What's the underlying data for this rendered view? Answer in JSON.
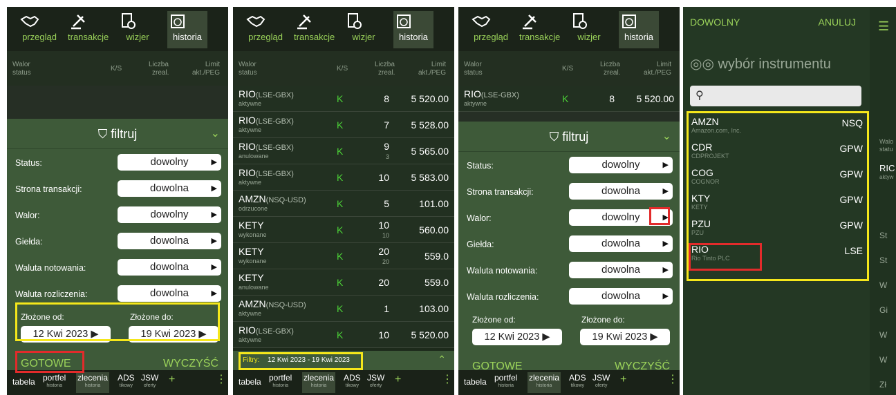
{
  "nav": {
    "tabs": [
      {
        "label": "przegląd",
        "icon": "handshake-icon"
      },
      {
        "label": "transakcje",
        "icon": "gavel-icon"
      },
      {
        "label": "wizjer",
        "icon": "document-clock-icon"
      },
      {
        "label": "historia",
        "icon": "calendar-clock-icon"
      }
    ],
    "active": "historia"
  },
  "columns": {
    "walor": "Walor",
    "status": "status",
    "ks": "K/S",
    "liczba": "Liczba",
    "zreal": "zreal.",
    "limit": "Limit",
    "akt_peg": "akt./PEG"
  },
  "orders": [
    {
      "name": "RIO",
      "market": "(LSE-GBX)",
      "status": "aktywne",
      "side": "K",
      "qty": "8",
      "realized": "",
      "limit": "5 520.00"
    },
    {
      "name": "RIO",
      "market": "(LSE-GBX)",
      "status": "aktywne",
      "side": "K",
      "qty": "7",
      "realized": "",
      "limit": "5 528.00"
    },
    {
      "name": "RIO",
      "market": "(LSE-GBX)",
      "status": "anulowane",
      "side": "K",
      "qty": "9",
      "realized": "3",
      "limit": "5 565.00"
    },
    {
      "name": "RIO",
      "market": "(LSE-GBX)",
      "status": "aktywne",
      "side": "K",
      "qty": "10",
      "realized": "",
      "limit": "5 583.00"
    },
    {
      "name": "AMZN",
      "market": "(NSQ-USD)",
      "status": "odrzucone",
      "side": "K",
      "qty": "5",
      "realized": "",
      "limit": "101.00"
    },
    {
      "name": "KETY",
      "market": "",
      "status": "wykonane",
      "side": "K",
      "qty": "10",
      "realized": "10",
      "limit": "560.00"
    },
    {
      "name": "KETY",
      "market": "",
      "status": "wykonane",
      "side": "K",
      "qty": "20",
      "realized": "20",
      "limit": "559.0"
    },
    {
      "name": "KETY",
      "market": "",
      "status": "anulowane",
      "side": "K",
      "qty": "20",
      "realized": "",
      "limit": "559.0"
    },
    {
      "name": "AMZN",
      "market": "(NSQ-USD)",
      "status": "aktywne",
      "side": "K",
      "qty": "1",
      "realized": "",
      "limit": "103.00"
    },
    {
      "name": "RIO",
      "market": "(LSE-GBX)",
      "status": "aktywne",
      "side": "K",
      "qty": "10",
      "realized": "",
      "limit": "5 520.00"
    }
  ],
  "filter": {
    "title": "filtruj",
    "rows": [
      {
        "label": "Status:",
        "value": "dowolny"
      },
      {
        "label": "Strona transakcji:",
        "value": "dowolna"
      },
      {
        "label": "Walor:",
        "value": "dowolny"
      },
      {
        "label": "Giełda:",
        "value": "dowolna"
      },
      {
        "label": "Waluta notowania:",
        "value": "dowolna"
      },
      {
        "label": "Waluta rozliczenia:",
        "value": "dowolna"
      }
    ],
    "from_label": "Złożone od:",
    "from_value": "12 Kwi 2023",
    "to_label": "Złożone do:",
    "to_value": "19 Kwi 2023",
    "done": "GOTOWE",
    "clear": "WYCZYŚĆ",
    "summary_label": "Filtry:",
    "summary_value": "12 Kwi 2023 - 19 Kwi 2023"
  },
  "bottom_tabs": [
    {
      "label": "tabela",
      "sub": ""
    },
    {
      "label": "portfel",
      "sub": "historia"
    },
    {
      "label": "zlecenia",
      "sub": "historia"
    },
    {
      "label": "ADS",
      "sub": "tikowy"
    },
    {
      "label": "JSW",
      "sub": "oferty"
    },
    {
      "label": "+",
      "sub": ""
    },
    {
      "label": "⋮",
      "sub": ""
    }
  ],
  "picker": {
    "any": "DOWOLNY",
    "cancel": "ANULUJ",
    "title": "wybór instrumentu",
    "search_placeholder": "",
    "items": [
      {
        "symbol": "AMZN",
        "name": "Amazon.com, Inc.",
        "exchange": "NSQ"
      },
      {
        "symbol": "CDR",
        "name": "CDPROJEKT",
        "exchange": "GPW"
      },
      {
        "symbol": "COG",
        "name": "COGNOR",
        "exchange": "GPW"
      },
      {
        "symbol": "KTY",
        "name": "KETY",
        "exchange": "GPW"
      },
      {
        "symbol": "PZU",
        "name": "PZU",
        "exchange": "GPW"
      },
      {
        "symbol": "RIO",
        "name": "Rio Tinto PLC",
        "exchange": "LSE"
      }
    ],
    "peek": {
      "walor": "Walo",
      "status": "statu",
      "row": "RIC",
      "row_status": "aktyw",
      "labels": [
        "St",
        "St",
        "W",
        "Gi",
        "W",
        "W",
        "Zł"
      ]
    }
  },
  "colors": {
    "accent_green": "#9bd35a",
    "buy_green": "#4cd137",
    "panel": "#3e5a39",
    "highlight_yellow": "#f5e71b",
    "highlight_red": "#e22b2b"
  }
}
